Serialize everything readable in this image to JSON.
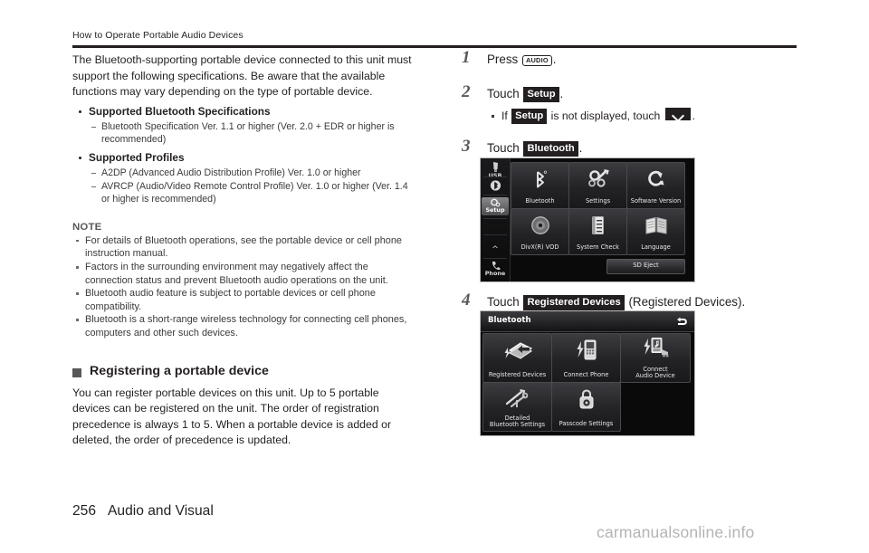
{
  "header": {
    "running_head": "How to Operate Portable Audio Devices"
  },
  "left_column": {
    "intro": "The Bluetooth-supporting portable device connected to this unit must support the following specifications. Be aware that the available functions may vary depending on the type of portable device.",
    "spec_groups": [
      {
        "title": "Supported Bluetooth Specifications",
        "items": [
          "Bluetooth Specification Ver. 1.1 or higher (Ver. 2.0 + EDR or higher is recommended)"
        ]
      },
      {
        "title": "Supported Profiles",
        "items": [
          "A2DP (Advanced Audio Distribution Profile) Ver. 1.0 or higher",
          "AVRCP (Audio/Video Remote Control Profile) Ver. 1.0 or higher (Ver. 1.4 or higher is recommended)"
        ]
      }
    ],
    "note": {
      "title": "NOTE",
      "items": [
        "For details of Bluetooth operations, see the portable device or cell phone instruction manual.",
        "Factors in the surrounding environment may negatively affect the connection status and prevent Bluetooth audio operations on the unit.",
        "Bluetooth audio feature is subject to portable devices or cell phone compatibility.",
        "Bluetooth is a short-range wireless technology for connecting cell phones, computers and other such devices."
      ]
    },
    "section": {
      "heading": "Registering a portable device",
      "body": "You can register portable devices on this unit. Up to 5 portable devices can be registered on the unit. The order of registration precedence is always 1 to 5. When a portable device is added or deleted, the order of precedence is updated."
    }
  },
  "right_column": {
    "steps": [
      {
        "num": "1",
        "lead": "Press",
        "key": "AUDIO",
        "tail": "."
      },
      {
        "num": "2",
        "lead": "Touch",
        "chip": "Setup",
        "tail": ".",
        "sub_lead": "If",
        "sub_chip": "Setup",
        "sub_mid": "is not displayed, touch",
        "sub_tail": "."
      },
      {
        "num": "3",
        "lead": "Touch",
        "chip": "Bluetooth",
        "tail": "."
      },
      {
        "num": "4",
        "lead": "Touch",
        "chip": "Registered Devices",
        "tail": "(Registered Devices)."
      }
    ]
  },
  "setup_screen": {
    "sidebar": [
      {
        "label": "USB",
        "icon": "usb-icon",
        "selected": false
      },
      {
        "label": "",
        "icon": "bluetooth-icon",
        "selected": false
      },
      {
        "label": "Setup",
        "icon": "setup-gear-icon",
        "selected": true
      },
      {
        "label": "^",
        "icon": "chevron-up-icon",
        "selected": false
      },
      {
        "label": "Phone",
        "icon": "phone-icon",
        "selected": false
      }
    ],
    "tiles": [
      {
        "label": "Bluetooth",
        "icon": "bluetooth-icon"
      },
      {
        "label": "Settings",
        "icon": "gears-wrench-icon"
      },
      {
        "label": "Software Version",
        "icon": "refresh-circle-icon"
      },
      {
        "label": "DivX(R) VOD",
        "icon": "disc-icon"
      },
      {
        "label": "System Check",
        "icon": "checklist-icon"
      },
      {
        "label": "Language",
        "icon": "book-icon"
      }
    ],
    "eject_button": "SD Eject"
  },
  "bluetooth_screen": {
    "title": "Bluetooth",
    "back_icon": "back-arrow-icon",
    "tiles": [
      {
        "label": "Registered Devices",
        "icon": "registered-devices-icon"
      },
      {
        "label": "Connect Phone",
        "icon": "connect-phone-icon"
      },
      {
        "label": "Connect\nAudio Device",
        "icon": "connect-audio-device-icon"
      },
      {
        "label": "Detailed\nBluetooth Settings",
        "icon": "tools-icon"
      },
      {
        "label": "Passcode Settings",
        "icon": "padlock-icon"
      }
    ]
  },
  "footer": {
    "page_number": "256",
    "chapter": "Audio and Visual",
    "watermark": "carmanualsonline.info"
  }
}
